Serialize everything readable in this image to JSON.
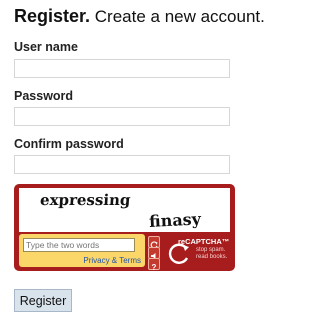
{
  "heading": {
    "strong": "Register.",
    "rest": " Create a new account."
  },
  "form": {
    "username_label": "User name",
    "password_label": "Password",
    "confirm_label": "Confirm password",
    "username_value": "",
    "password_value": "",
    "confirm_value": ""
  },
  "captcha": {
    "word1": "expressing",
    "word2": "finasy",
    "input_placeholder": "Type the two words",
    "privacy_link": "Privacy & Terms",
    "brand": "reCAPTCHA™",
    "tagline_line1": "stop spam.",
    "tagline_line2": "read books.",
    "colors": {
      "frame": "#a71d1d",
      "panel": "#fbd769"
    },
    "icons": [
      "refresh-icon",
      "audio-icon",
      "help-icon"
    ]
  },
  "submit_label": "Register"
}
